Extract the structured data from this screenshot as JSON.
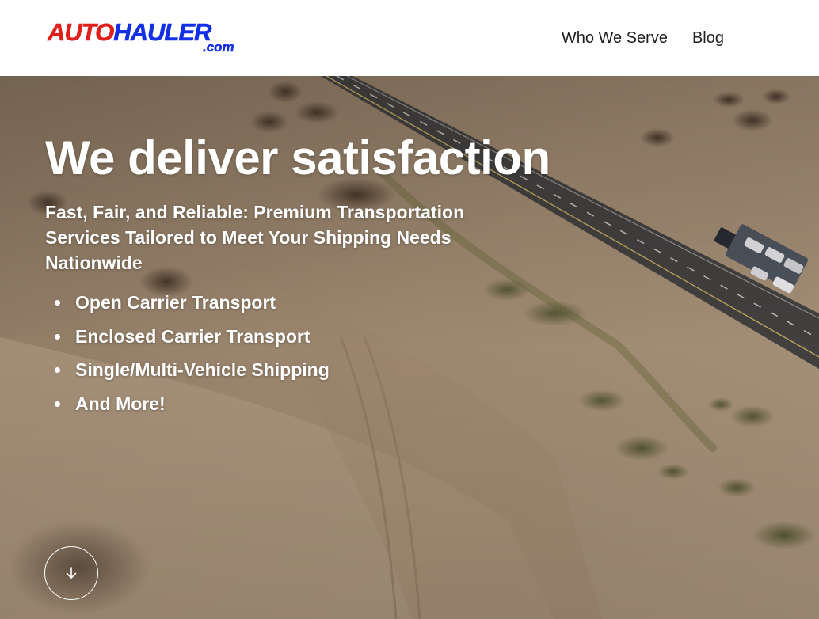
{
  "brand": {
    "logo_text_1": "AUTO",
    "logo_text_2": "HAULER",
    "logo_text_3": ".com",
    "color_red": "#e0201c",
    "color_blue": "#1430e6"
  },
  "nav": {
    "items": [
      {
        "label": "Who We Serve"
      },
      {
        "label": "Blog"
      }
    ]
  },
  "hero": {
    "title": "We deliver satisfaction",
    "subtitle": "Fast, Fair, and Reliable: Premium Transportation Services Tailored to Meet Your Shipping Needs Nationwide",
    "services": [
      "Open Carrier Transport",
      "Enclosed Carrier Transport",
      "Single/Multi-Vehicle Shipping",
      "And More!"
    ],
    "scroll_icon": "arrow-down-icon",
    "background": "aerial desert highway with car carrier truck"
  }
}
